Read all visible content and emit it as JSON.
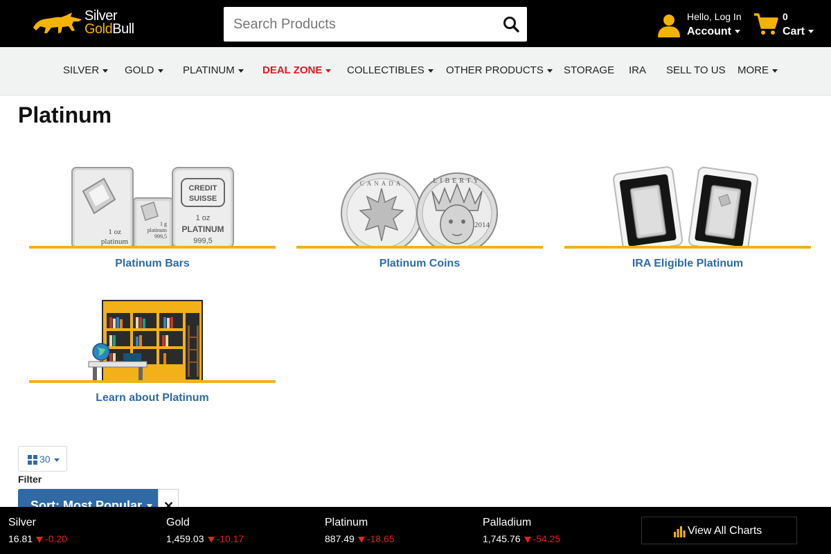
{
  "brand": {
    "line1": "Silver",
    "line2_gold": "Gold",
    "line2_rest": "Bull",
    "accent": "#f5b301"
  },
  "search": {
    "placeholder": "Search Products",
    "icon": "search-icon"
  },
  "account": {
    "greeting": "Hello, Log In",
    "label": "Account"
  },
  "cart": {
    "count": "0",
    "label": "Cart"
  },
  "nav": {
    "items": [
      {
        "label": "SILVER",
        "dropdown": true
      },
      {
        "label": "GOLD",
        "dropdown": true
      },
      {
        "label": "PLATINUM",
        "dropdown": true
      },
      {
        "label": "DEAL ZONE",
        "dropdown": true,
        "highlight": "#d71920"
      },
      {
        "label": "COLLECTIBLES",
        "dropdown": true
      },
      {
        "label": "OTHER PRODUCTS",
        "dropdown": true
      },
      {
        "label": "STORAGE",
        "dropdown": false
      },
      {
        "label": "IRA",
        "dropdown": false
      },
      {
        "label": "SELL TO US",
        "dropdown": false
      },
      {
        "label": "MORE",
        "dropdown": true
      }
    ]
  },
  "page": {
    "title": "Platinum"
  },
  "categories": [
    {
      "name": "Platinum Bars",
      "bar_labels": {
        "small": "1 oz",
        "small2": "platinum",
        "tiny": "1 g",
        "tiny2": "platinum",
        "tiny3": "999,5",
        "brand1": "CREDIT",
        "brand2": "SUISSE",
        "weight": "1 oz",
        "metal": "PLATINUM",
        "purity": "999,5"
      }
    },
    {
      "name": "Platinum Coins",
      "coin_labels": {
        "left": "CANADA",
        "right": "LIBERTY",
        "year": "2014"
      }
    },
    {
      "name": "IRA Eligible Platinum"
    },
    {
      "name": "Learn about Platinum"
    }
  ],
  "listing": {
    "per_page": "30",
    "filter_label": "Filter",
    "sort_label": "Sort: Most Popular",
    "clear": "✕"
  },
  "ticker": {
    "metals": [
      {
        "name": "Silver",
        "price": "16.81",
        "change": "-0.20"
      },
      {
        "name": "Gold",
        "price": "1,459.03",
        "change": "-10.17"
      },
      {
        "name": "Platinum",
        "price": "887.49",
        "change": "-18.65"
      },
      {
        "name": "Palladium",
        "price": "1,745.76",
        "change": "-54.25"
      }
    ],
    "charts_button": "View All Charts",
    "down_color": "#e5211d"
  }
}
